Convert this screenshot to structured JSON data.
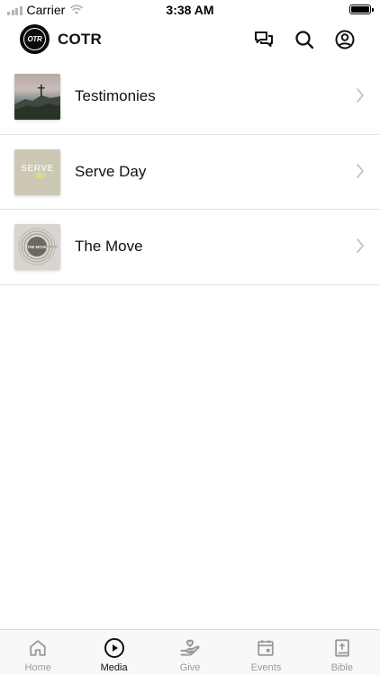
{
  "status_bar": {
    "carrier": "Carrier",
    "time": "3:38 AM"
  },
  "header": {
    "logo_text": "OTR",
    "title": "COTR",
    "icons": [
      "chat-icon",
      "search-icon",
      "account-icon"
    ]
  },
  "media_list": {
    "items": [
      {
        "label": "Testimonies",
        "thumbnail": "mountain-cross-photo"
      },
      {
        "label": "Serve Day",
        "thumbnail": "serve-day-artwork",
        "thumbnail_text": "SERVE",
        "thumbnail_subtext": "day"
      },
      {
        "label": "The Move",
        "thumbnail": "the-move-artwork",
        "thumbnail_text": "THE MOVE"
      }
    ]
  },
  "tab_bar": {
    "active": "Media",
    "tabs": [
      {
        "label": "Home",
        "icon": "home-icon"
      },
      {
        "label": "Media",
        "icon": "play-icon"
      },
      {
        "label": "Give",
        "icon": "give-icon"
      },
      {
        "label": "Events",
        "icon": "calendar-icon"
      },
      {
        "label": "Bible",
        "icon": "bible-icon"
      }
    ]
  },
  "colors": {
    "active_tab": "#111111",
    "inactive_tab": "#9a9a9a",
    "divider": "#e4e4e4",
    "logo_bg": "#0b0b0b"
  }
}
